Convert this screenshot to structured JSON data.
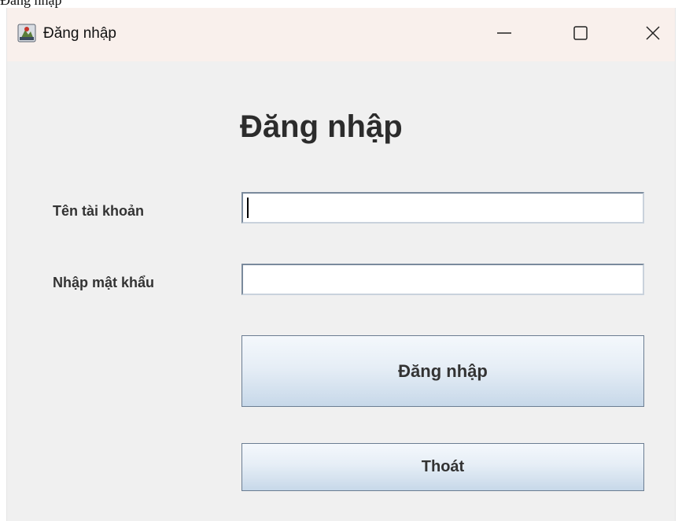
{
  "page_above": {
    "partial_text": "Đăng nhập"
  },
  "window": {
    "title": "Đăng nhập",
    "icon": "java-app-icon",
    "controls": {
      "minimize": "minimize-icon",
      "maximize": "maximize-icon",
      "close": "close-icon"
    }
  },
  "form": {
    "heading": "Đăng nhập",
    "username": {
      "label": "Tên tài khoản",
      "value": "",
      "placeholder": ""
    },
    "password": {
      "label": "Nhập mật khẩu",
      "value": "",
      "placeholder": ""
    },
    "login_button": "Đăng nhập",
    "exit_button": "Thoát"
  },
  "colors": {
    "titlebar_bg": "#f9f0ec",
    "content_bg": "#f0f0f0",
    "button_border": "#6b7d92"
  }
}
